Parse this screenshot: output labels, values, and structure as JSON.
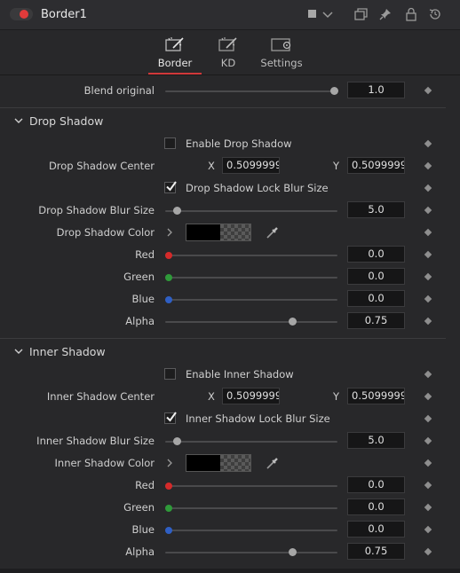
{
  "header": {
    "node_name": "Border1",
    "toggle_color": "#e03b3b",
    "icons": [
      "color-swatch-icon",
      "chevron-down-icon",
      "windows-icon",
      "pin-icon",
      "lock-icon",
      "reset-icon"
    ]
  },
  "tabs": [
    {
      "label": "Border",
      "icon": "wand-icon",
      "active": true
    },
    {
      "label": "KD",
      "icon": "wand-icon",
      "active": false
    },
    {
      "label": "Settings",
      "icon": "settings-icon",
      "active": false
    }
  ],
  "blend": {
    "label": "Blend original",
    "value": "1.0",
    "slider_fraction": 1.0
  },
  "drop_shadow": {
    "title": "Drop Shadow",
    "enable_label": "Enable Drop Shadow",
    "enable_checked": false,
    "center_label": "Drop Shadow Center",
    "x_label": "X",
    "x_value": "0.5099999",
    "y_label": "Y",
    "y_value": "0.5099999",
    "lock_label": "Drop Shadow Lock Blur Size",
    "lock_checked": true,
    "blur_label": "Drop Shadow Blur Size",
    "blur_value": "5.0",
    "color_label": "Drop Shadow Color",
    "red_label": "Red",
    "red_value": "0.0",
    "green_label": "Green",
    "green_value": "0.0",
    "blue_label": "Blue",
    "blue_value": "0.0",
    "alpha_label": "Alpha",
    "alpha_value": "0.75"
  },
  "inner_shadow": {
    "title": "Inner Shadow",
    "enable_label": "Enable Inner Shadow",
    "enable_checked": false,
    "center_label": "Inner Shadow Center",
    "x_label": "X",
    "x_value": "0.5099999",
    "y_label": "Y",
    "y_value": "0.5099999",
    "lock_label": "Inner Shadow Lock Blur Size",
    "lock_checked": true,
    "blur_label": "Inner Shadow Blur Size",
    "blur_value": "5.0",
    "color_label": "Inner Shadow Color",
    "red_label": "Red",
    "red_value": "0.0",
    "green_label": "Green",
    "green_value": "0.0",
    "blue_label": "Blue",
    "blue_value": "0.0",
    "alpha_label": "Alpha",
    "alpha_value": "0.75"
  },
  "colors": {
    "red": "#d42a2a",
    "green": "#2f9a3a",
    "blue": "#2f5fc4",
    "accent": "#d0383a"
  }
}
